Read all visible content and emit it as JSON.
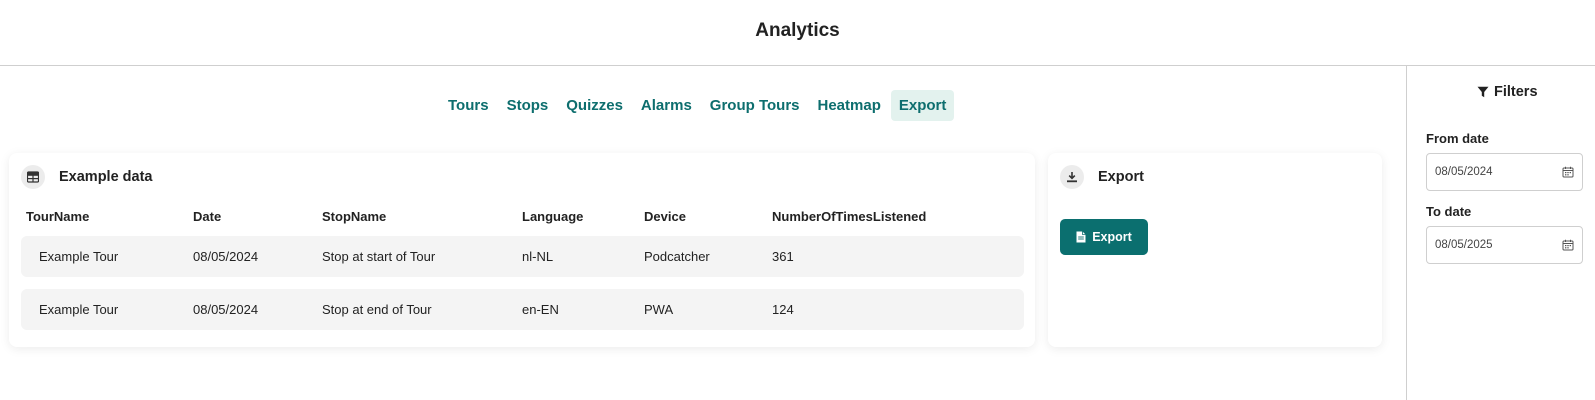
{
  "header": {
    "title": "Analytics"
  },
  "tabs": [
    {
      "label": "Tours"
    },
    {
      "label": "Stops"
    },
    {
      "label": "Quizzes"
    },
    {
      "label": "Alarms"
    },
    {
      "label": "Group Tours"
    },
    {
      "label": "Heatmap"
    },
    {
      "label": "Export",
      "active": true
    }
  ],
  "data_card": {
    "title": "Example data",
    "icon": "table-icon",
    "columns": [
      "TourName",
      "Date",
      "StopName",
      "Language",
      "Device",
      "NumberOfTimesListened"
    ],
    "rows": [
      [
        "Example Tour",
        "08/05/2024",
        "Stop at start of Tour",
        "nl-NL",
        "Podcatcher",
        "361"
      ],
      [
        "Example Tour",
        "08/05/2024",
        "Stop at end of Tour",
        "en-EN",
        "PWA",
        "124"
      ]
    ]
  },
  "export_card": {
    "title": "Export",
    "icon": "download-icon",
    "button_label": "Export",
    "button_icon": "file-icon"
  },
  "filters": {
    "heading": "Filters",
    "icon": "filter-icon",
    "from_label": "From date",
    "from_value": "08/05/2024",
    "to_label": "To date",
    "to_value": "08/05/2025",
    "calendar_icon": "calendar-icon"
  },
  "colors": {
    "accent": "#0b6f6f",
    "tab_text": "#0d6e6e",
    "tab_active_bg": "#e3f2ee",
    "row_bg": "#f4f4f4"
  }
}
